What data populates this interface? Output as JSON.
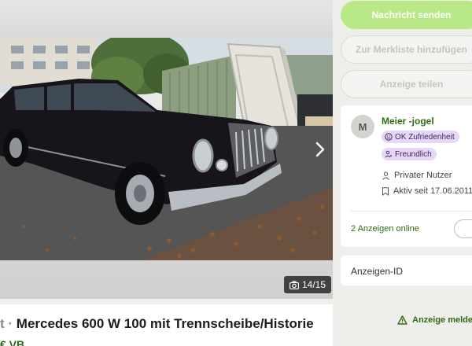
{
  "listing": {
    "title_prefix": "t ·",
    "title": "Mercedes 600 W 100 mit Trennscheibe/Historie",
    "price": "€ VB",
    "image_counter": "14/15"
  },
  "actions": {
    "message_label": "Nachricht senden",
    "watchlist_label": "Zur Merkliste hinzufügen",
    "share_label": "Anzeige teilen"
  },
  "seller": {
    "initial": "M",
    "name": "Meier -jogel",
    "badges": [
      "OK Zufriedenheit",
      "Freundlich"
    ],
    "type": "Privater Nutzer",
    "active_since": "Aktiv seit 17.06.2011",
    "ads_online": "2 Anzeigen online"
  },
  "ad_id": {
    "label": "Anzeigen-ID"
  },
  "report": {
    "label": "Anzeige melden"
  },
  "colors": {
    "accent_green": "#326916",
    "primary_button": "#b8e986",
    "badge_purple": "#e6d7f7"
  }
}
